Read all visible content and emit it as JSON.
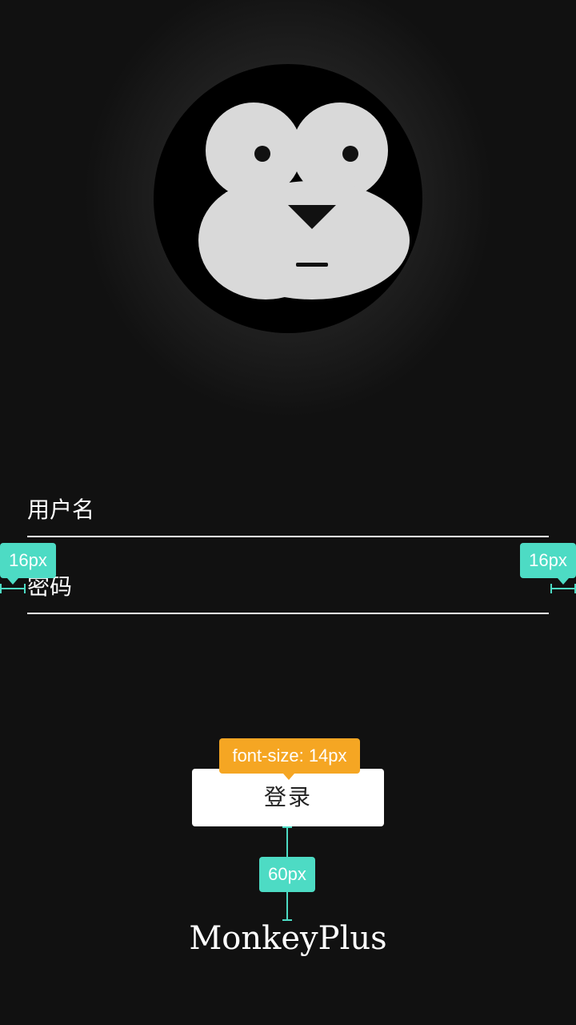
{
  "login_form": {
    "username_label": "用户名",
    "password_label": "密码",
    "login_button_label": "登录"
  },
  "brand": {
    "name": "MonkeyPlus"
  },
  "annotations": {
    "left_margin": "16px",
    "right_margin": "16px",
    "button_font_size": "font-size: 14px",
    "button_to_brand_gap": "60px"
  },
  "colors": {
    "background": "#111111",
    "text": "#ffffff",
    "annotation_teal": "#4ddbc4",
    "annotation_orange": "#f5a623",
    "logo_face": "#d9d9d9"
  },
  "icons": {
    "logo": "monkey-face-icon"
  }
}
